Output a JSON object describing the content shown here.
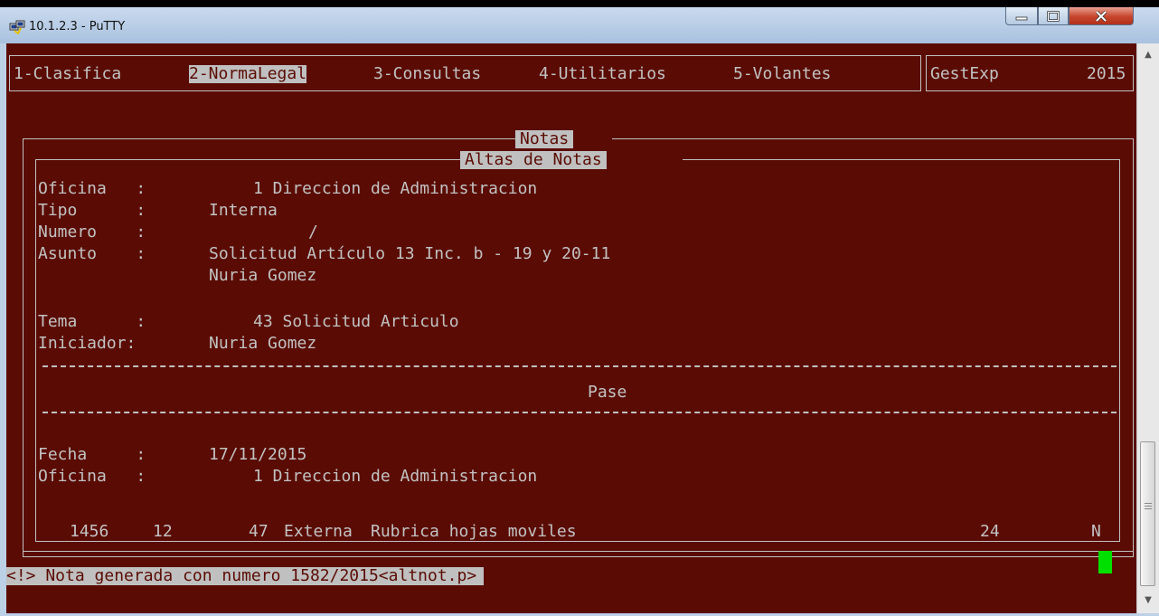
{
  "window": {
    "title": "10.1.2.3 - PuTTY",
    "icons": {
      "app": "putty-icon",
      "minimize": "minimize-icon",
      "maximize": "maximize-icon",
      "close": "close-icon"
    }
  },
  "menu": {
    "items": [
      "1-Clasifica",
      "2-NormaLegal",
      "3-Consultas",
      "4-Utilitarios",
      "5-Volantes"
    ],
    "selected_index": 1,
    "system_name": "GestExp",
    "year": "2015"
  },
  "notas_title": "Notas",
  "altas_title": "Altas de Notas",
  "form": {
    "oficina_label": "Oficina   :",
    "oficina_value": "1 Direccion de Administracion",
    "tipo_label": "Tipo      :",
    "tipo_value": "Interna",
    "numero_label": "Numero    :",
    "numero_value": "/",
    "asunto_label": "Asunto    :",
    "asunto_line1": "Solicitud Artículo 13 Inc. b - 19 y 20-11",
    "asunto_line2": "Nuria Gomez",
    "tema_label": "Tema      :",
    "tema_value": "43 Solicitud Articulo",
    "iniciador_label": "Iniciador:",
    "iniciador_value": "Nuria Gomez"
  },
  "pase": {
    "title": "Pase",
    "fecha_label": "Fecha     :",
    "fecha_value": "17/11/2015",
    "oficina_label": "Oficina   :",
    "oficina_value": "1 Direccion de Administracion"
  },
  "record_row": {
    "col1": "1456",
    "col2": "12",
    "col3": "47",
    "col4": "Externa",
    "col5": "Rubrica hojas moviles",
    "col6": "24",
    "col7": "N"
  },
  "status_message": "<!> Nota generada con numero 1582/2015<altnot.p>",
  "colors": {
    "terminal_bg": "#5a0c04",
    "terminal_fg": "#c0c0c0",
    "cursor": "#00e000"
  }
}
